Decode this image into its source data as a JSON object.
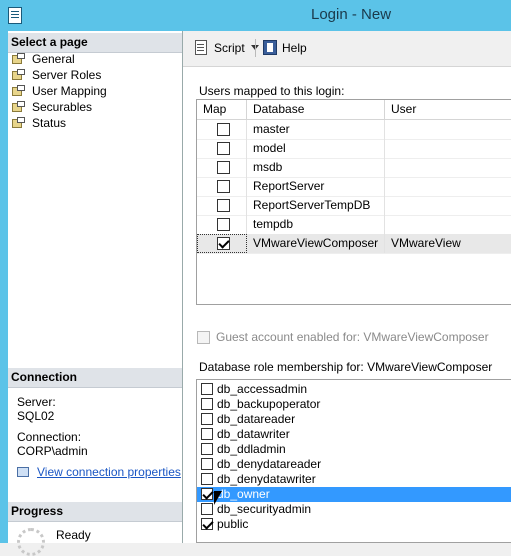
{
  "window": {
    "title": "Login - New",
    "title_icon": "document-icon"
  },
  "left": {
    "select_header": "Select a page",
    "pages": [
      {
        "label": "General",
        "icon": "page-icon",
        "selected": false
      },
      {
        "label": "Server Roles",
        "icon": "page-icon",
        "selected": false
      },
      {
        "label": "User Mapping",
        "icon": "page-icon",
        "selected": true
      },
      {
        "label": "Securables",
        "icon": "page-icon",
        "selected": false
      },
      {
        "label": "Status",
        "icon": "page-icon",
        "selected": false
      }
    ],
    "connection_header": "Connection",
    "server_label": "Server:",
    "server_value": "SQL02",
    "connection_label": "Connection:",
    "connection_value": "CORP\\admin",
    "view_link": "View connection properties",
    "progress_header": "Progress",
    "progress_status": "Ready"
  },
  "toolbar": {
    "script_label": "Script",
    "help_label": "Help"
  },
  "mapping": {
    "label": "Users mapped to this login:",
    "columns": [
      "Map",
      "Database",
      "User"
    ],
    "rows": [
      {
        "map": false,
        "database": "master",
        "user": ""
      },
      {
        "map": false,
        "database": "model",
        "user": ""
      },
      {
        "map": false,
        "database": "msdb",
        "user": ""
      },
      {
        "map": false,
        "database": "ReportServer",
        "user": ""
      },
      {
        "map": false,
        "database": "ReportServerTempDB",
        "user": ""
      },
      {
        "map": false,
        "database": "tempdb",
        "user": ""
      },
      {
        "map": true,
        "database": "VMwareViewComposer",
        "user": "VMwareView",
        "selected": true
      }
    ]
  },
  "guest": {
    "label": "Guest account enabled for: VMwareViewComposer",
    "checked": false,
    "disabled": true
  },
  "roles": {
    "label": "Database role membership for: VMwareViewComposer",
    "items": [
      {
        "label": "db_accessadmin",
        "checked": false
      },
      {
        "label": "db_backupoperator",
        "checked": false
      },
      {
        "label": "db_datareader",
        "checked": false
      },
      {
        "label": "db_datawriter",
        "checked": false
      },
      {
        "label": "db_ddladmin",
        "checked": false
      },
      {
        "label": "db_denydatareader",
        "checked": false
      },
      {
        "label": "db_denydatawriter",
        "checked": false
      },
      {
        "label": "db_owner",
        "checked": true,
        "selected": true
      },
      {
        "label": "db_securityadmin",
        "checked": false
      },
      {
        "label": "public",
        "checked": true
      }
    ]
  }
}
